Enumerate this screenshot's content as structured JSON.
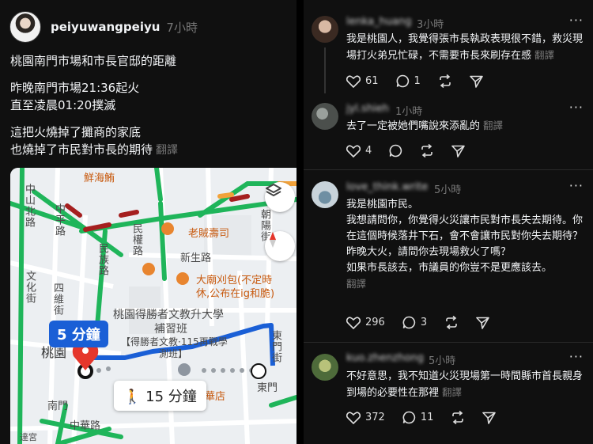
{
  "post": {
    "username": "peiyuwangpeiyu",
    "time": "7小時",
    "lines": [
      "桃園南門市場和市長官邸的距離",
      "昨晚南門市場21:36起火",
      "直至凌晨01:20撲滅",
      "這把火燒掉了攤商的家底",
      "也燒掉了市民對市長的期待"
    ],
    "translate": "翻譯"
  },
  "map": {
    "labels": {
      "xianhaiyu": "鮮海鮪",
      "zhongshanbei": "中山北路",
      "zhongping": "中平路",
      "minquan": "民權路",
      "minzu": "民族路",
      "xinsheng": "新生路",
      "laozei": "老賊壽司",
      "dake1": "大廟刈包(不定時",
      "dake2": "休,公布在ig和脆)",
      "wenhua": "文化街",
      "sihai": "四維街",
      "chaoyang": "朝陽街",
      "dongmenjie": "東門街",
      "school1": "桃園得勝者文教升大學",
      "school2": "補習班",
      "school3": "【得勝者文教·115再戰學",
      "school4": "測班】",
      "taoyuan": "桃園",
      "nanmen": "南門",
      "dongmen": "東門",
      "huadian": "華店",
      "zhonghua": "中華路",
      "cut": "達宮"
    },
    "drive_time": "5 分鐘",
    "walk_time": "15 分鐘"
  },
  "comments": [
    {
      "name": "lenka_huang",
      "time": "3小時",
      "text": "我是桃園人，我覺得張市長執政表現很不錯，救災現場打火弟兄忙碌，不需要市長來刷存在感",
      "translate": "翻譯",
      "likes": "61",
      "replies": "1",
      "reposts": ""
    },
    {
      "name": "jyl.shieh",
      "time": "1小時",
      "text": "去了一定被她們嘴說來添亂的",
      "translate": "翻譯",
      "likes": "4",
      "replies": "",
      "reposts": ""
    },
    {
      "name": "love_think.write",
      "time": "5小時",
      "lines": [
        "我是桃園市民。",
        "我想請問你，你覺得火災讓市民對市長失去期待。你在這個時候落井下石，會不會讓市民對你失去期待？",
        "昨晚大火，請問你去現場救火了嗎？",
        "如果市長該去，市議員的你豈不是更應該去。"
      ],
      "translate": "翻譯",
      "likes": "296",
      "replies": "3",
      "reposts": ""
    },
    {
      "name": "kuo.zhenzhong",
      "time": "5小時",
      "text": "不好意思，我不知道火災現場第一時間縣市首長親身到場的必要性在那裡",
      "translate": "翻譯",
      "likes": "372",
      "replies": "11",
      "reposts": ""
    }
  ],
  "colors": {
    "background": "#101010",
    "muted": "#777777",
    "route_blue": "#1a5fd6",
    "traffic_green": "#1fb55a",
    "traffic_red": "#a51f1f",
    "pin_red": "#e5362b"
  }
}
